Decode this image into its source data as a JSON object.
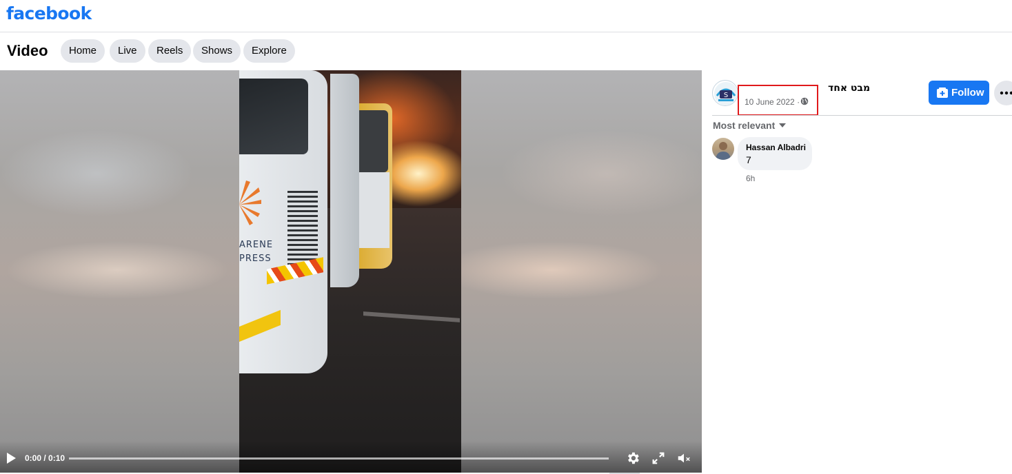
{
  "header": {
    "logo": "facebook"
  },
  "subnav": {
    "title": "Video",
    "pills": [
      "Home",
      "Live",
      "Reels",
      "Shows",
      "Explore"
    ]
  },
  "video": {
    "time": "0:00 / 0:10",
    "progress_fraction": 0,
    "controls": {
      "play_icon": "play-icon",
      "settings_icon": "gear-icon",
      "fullscreen_icon": "expand-icon",
      "volume_icon": "muted-speaker-icon"
    },
    "scene_text": [
      "ARENE",
      "PRESS"
    ]
  },
  "post": {
    "page_name": "מבט אחד",
    "date": "10 June 2022 ·",
    "privacy_icon": "globe-icon",
    "follow_label": "Follow",
    "more_icon": "more-dots-icon",
    "highlight_color": "#e0191b"
  },
  "comments": {
    "sort_label": "Most relevant",
    "items": [
      {
        "author": "Hassan Albadri",
        "text": "7",
        "time": "6h"
      }
    ]
  },
  "colors": {
    "brand": "#1877f2",
    "pill_bg": "#e4e6eb",
    "secondary_text": "#65676b"
  }
}
